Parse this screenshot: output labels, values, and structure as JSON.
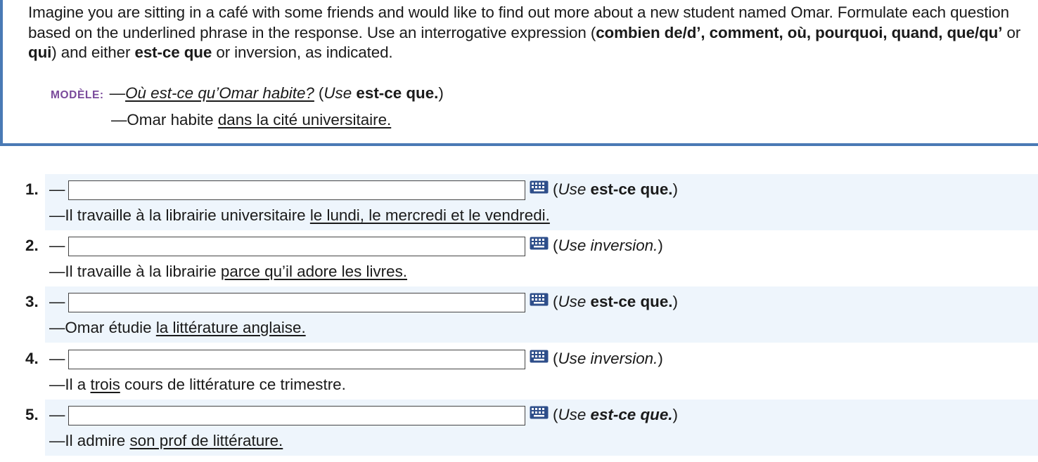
{
  "instructions": {
    "part1": "Imagine you are sitting in a café with some friends and would like to find out more about a new student named Omar. Formulate each question based on the underlined phrase in the response. Use an interrogative expression (",
    "expressions": "combien de/d’, comment, où, pourquoi, quand, que/qu’",
    "part2": " or ",
    "qui": "qui",
    "part3": ") and either ",
    "estceque": "est-ce que",
    "part4": " or inversion, as indicated."
  },
  "modele": {
    "label": "MODÈLE:",
    "dash": "—",
    "question": "Où est-ce qu’Omar habite?",
    "use_open": "(",
    "use_word": "Use",
    "use_bold": "est-ce que.",
    "use_close": ")",
    "answer_prefix": "—Omar habite ",
    "answer_underlined": "dans la cité universitaire."
  },
  "items": [
    {
      "number": "1.",
      "dash": "—",
      "input_value": "",
      "note_open": "(",
      "note_use": "Use",
      "note_method": "est-ce que.",
      "note_close": ")",
      "response_prefix": "—Il travaille à la librairie universitaire ",
      "response_underlined": "le lundi, le mercredi et le vendredi.",
      "response_suffix": ""
    },
    {
      "number": "2.",
      "dash": "—",
      "input_value": "",
      "note_open": "(",
      "note_use": "Use",
      "note_method": "inversion.",
      "note_close": ")",
      "response_prefix": "—Il travaille à la librairie ",
      "response_underlined": "parce qu’il adore les livres.",
      "response_suffix": ""
    },
    {
      "number": "3.",
      "dash": "—",
      "input_value": "",
      "note_open": "(",
      "note_use": "Use",
      "note_method": "est-ce que.",
      "note_close": ")",
      "response_prefix": "—Omar étudie ",
      "response_underlined": "la littérature anglaise.",
      "response_suffix": ""
    },
    {
      "number": "4.",
      "dash": "—",
      "input_value": "",
      "note_open": "(",
      "note_use": "Use",
      "note_method": "inversion.",
      "note_close": ")",
      "response_prefix": "—Il a ",
      "response_underlined": "trois",
      "response_suffix": " cours de littérature ce trimestre."
    },
    {
      "number": "5.",
      "dash": "—",
      "input_value": "",
      "note_open": "(",
      "note_use": "Use",
      "note_method": "est-ce que.",
      "note_close": ")",
      "response_prefix": "—Il admire ",
      "response_underlined": "son prof de littérature.",
      "response_suffix": ""
    }
  ],
  "icons": {
    "keyboard": "keyboard-icon"
  },
  "colors": {
    "accent_border": "#4a7ab5",
    "modele_label": "#7a4a9b",
    "item_background": "#eef5fc",
    "keyboard_icon": "#2e4e8a"
  }
}
